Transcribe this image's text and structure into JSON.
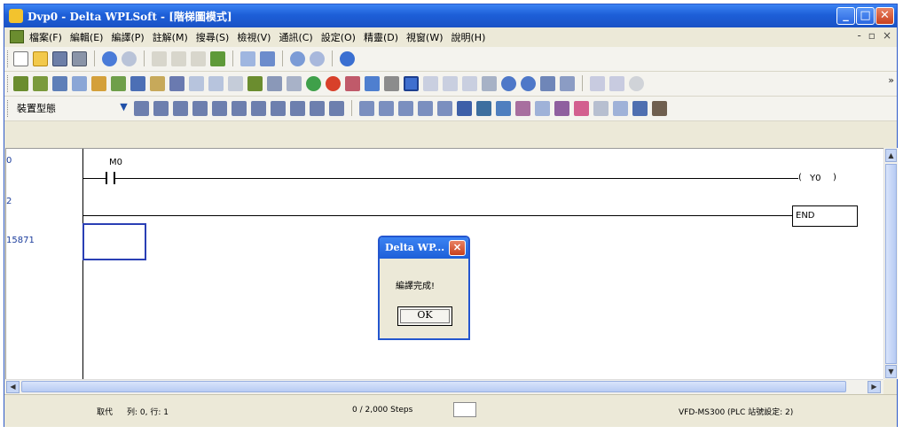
{
  "window": {
    "title": "Dvp0 - Delta WPLSoft - [階梯圖模式]"
  },
  "menu": {
    "items": [
      "檔案(F)",
      "編輯(E)",
      "編譯(P)",
      "註解(M)",
      "搜尋(S)",
      "檢視(V)",
      "通訊(C)",
      "設定(O)",
      "精靈(D)",
      "視窗(W)",
      "說明(H)"
    ],
    "mdi_minimize": "-",
    "mdi_restore": "▫",
    "mdi_close": "×"
  },
  "toolbar4": {
    "combo_label": "裝置型態"
  },
  "ladder": {
    "line_numbers": [
      "0",
      "2",
      "15871"
    ],
    "contact_label": "M0",
    "coil_label": "Y0",
    "end_label": "END",
    "coil_open": "(",
    "coil_close": ")"
  },
  "dialog": {
    "title": "Delta WP...",
    "message": "編譯完成!",
    "ok_label": "OK"
  },
  "status": {
    "mode": "取代",
    "position": "列: 0, 行: 1",
    "steps": "0 / 2,000 Steps",
    "device": "VFD-MS300 (PLC 站號設定: 2)"
  },
  "colors": {
    "title_bar": "#1d5fd8",
    "close_red": "#c8411e",
    "line_number": "#1a3c9c",
    "selection": "#2a3fb5"
  }
}
